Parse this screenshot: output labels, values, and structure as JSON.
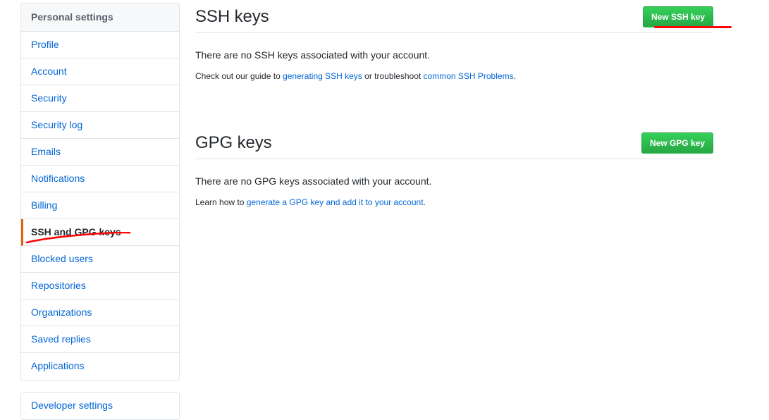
{
  "sidebar": {
    "header": "Personal settings",
    "items": [
      {
        "label": "Profile",
        "selected": false
      },
      {
        "label": "Account",
        "selected": false
      },
      {
        "label": "Security",
        "selected": false
      },
      {
        "label": "Security log",
        "selected": false
      },
      {
        "label": "Emails",
        "selected": false
      },
      {
        "label": "Notifications",
        "selected": false
      },
      {
        "label": "Billing",
        "selected": false
      },
      {
        "label": "SSH and GPG keys",
        "selected": true
      },
      {
        "label": "Blocked users",
        "selected": false
      },
      {
        "label": "Repositories",
        "selected": false
      },
      {
        "label": "Organizations",
        "selected": false
      },
      {
        "label": "Saved replies",
        "selected": false
      },
      {
        "label": "Applications",
        "selected": false
      }
    ],
    "secondary_items": [
      {
        "label": "Developer settings"
      }
    ]
  },
  "ssh_section": {
    "title": "SSH keys",
    "button_label": "New SSH key",
    "empty_message": "There are no SSH keys associated with your account.",
    "help_prefix": "Check out our guide to ",
    "help_link_1": "generating SSH keys",
    "help_middle": " or troubleshoot ",
    "help_link_2": "common SSH Problems",
    "help_suffix": "."
  },
  "gpg_section": {
    "title": "GPG keys",
    "button_label": "New GPG key",
    "empty_message": "There are no GPG keys associated with your account.",
    "help_prefix": "Learn how to ",
    "help_link_1": "generate a GPG key and add it to your account",
    "help_suffix": "."
  },
  "annotations": {
    "color": "#fb0707",
    "button_underline": "straight-line-under-new-ssh-key-button",
    "nav_underline": "curved-line-under-ssh-and-gpg-keys"
  },
  "colors": {
    "link": "#0366d6",
    "text": "#24292e",
    "muted": "#586069",
    "border": "#e1e4e8",
    "header_bg": "#f6f8fa",
    "button_green": "#2cbe4e",
    "selected_marker": "#e36209",
    "annotation_red": "#fb0707"
  }
}
